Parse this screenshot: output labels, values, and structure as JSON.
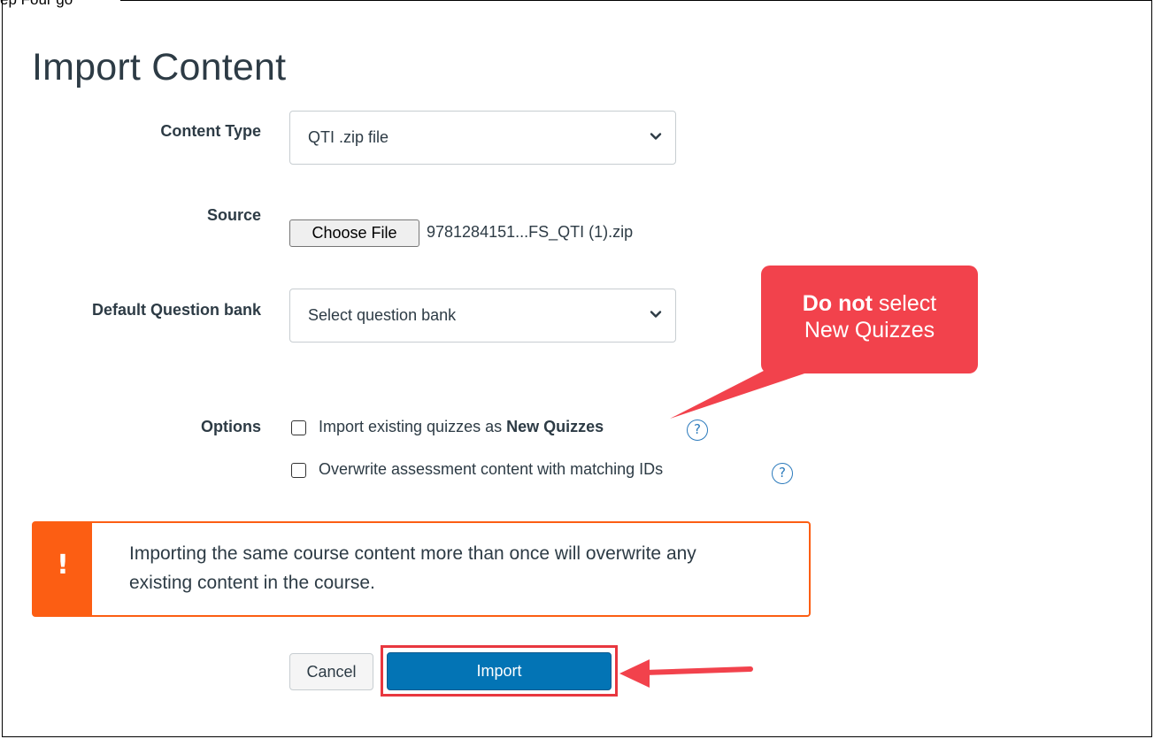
{
  "top_text": "ep Four go",
  "title": "Import Content",
  "form": {
    "content_type": {
      "label": "Content Type",
      "value": "QTI .zip file"
    },
    "source": {
      "label": "Source",
      "button": "Choose File",
      "file_name": "9781284151...FS_QTI (1).zip"
    },
    "question_bank": {
      "label": "Default Question bank",
      "value": "Select question bank"
    },
    "options": {
      "label": "Options",
      "items": [
        {
          "text": "Import existing quizzes as ",
          "bold": "New Quizzes",
          "help": "?"
        },
        {
          "text": "Overwrite assessment content with matching IDs",
          "bold": "",
          "help": "?"
        }
      ]
    }
  },
  "alert": {
    "icon": "!",
    "message": "Importing the same course content more than once will overwrite any existing content in the course."
  },
  "buttons": {
    "cancel": "Cancel",
    "import": "Import"
  },
  "callout": {
    "bold": "Do not",
    "line1_rest": " select",
    "line2": "New Quizzes"
  },
  "colors": {
    "accent": "#0374b5",
    "warning": "#fc5e13",
    "annotation": "#f2424c",
    "text": "#2d3b45"
  },
  "icons": [
    "chevron-down-icon",
    "help-icon",
    "warning-icon",
    "arrow-icon"
  ]
}
